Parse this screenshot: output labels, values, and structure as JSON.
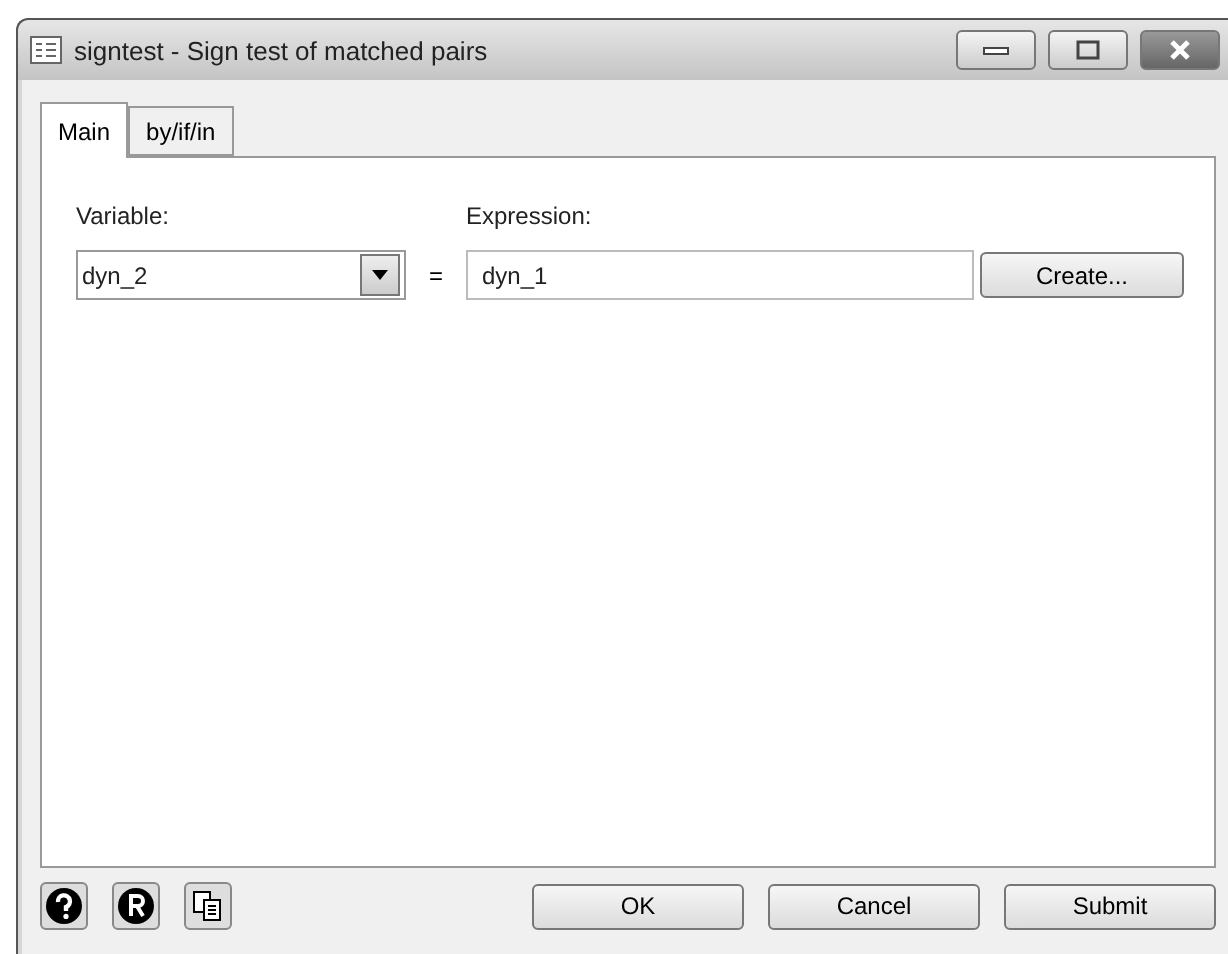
{
  "window": {
    "title": "signtest - Sign test of matched pairs"
  },
  "tabs": [
    {
      "label": "Main",
      "selected": true
    },
    {
      "label": "by/if/in",
      "selected": false
    }
  ],
  "variable": {
    "label": "Variable:",
    "value": "dyn_2"
  },
  "equals": "=",
  "expression": {
    "label": "Expression:",
    "value": "dyn_1"
  },
  "create_button": "Create...",
  "buttons": [
    "OK",
    "Cancel",
    "Submit"
  ]
}
